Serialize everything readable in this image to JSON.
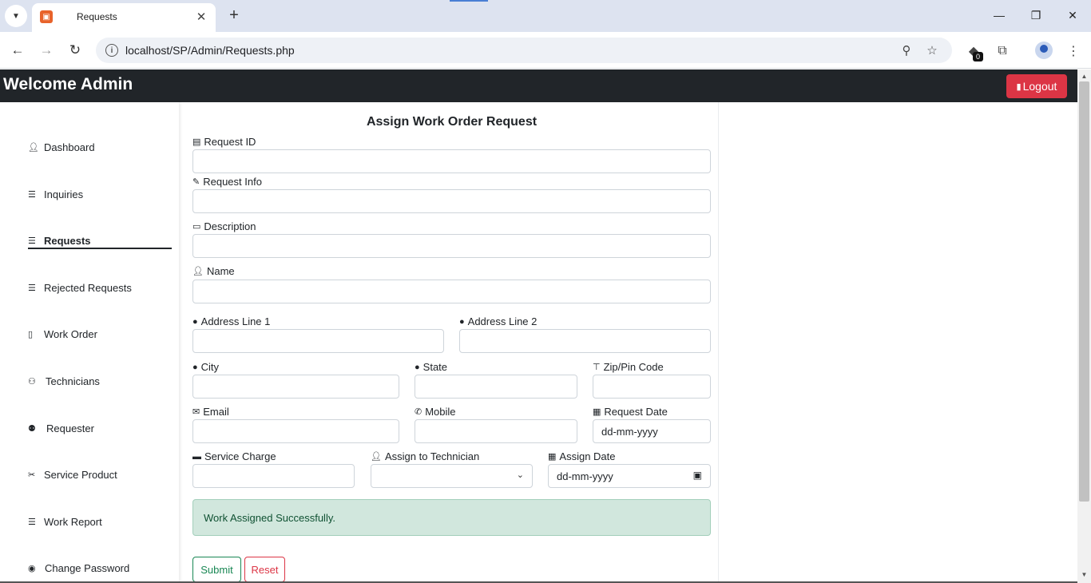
{
  "browser": {
    "tab_title": "Requests",
    "url": "localhost/SP/Admin/Requests.php",
    "extension_badge": "0"
  },
  "header": {
    "brand": "Welcome Admin",
    "logout_label": "Logout"
  },
  "sidebar": {
    "items": [
      {
        "label": "Dashboard",
        "icon": "user-icon"
      },
      {
        "label": "Inquiries",
        "icon": "list-icon"
      },
      {
        "label": "Requests",
        "icon": "list-icon"
      },
      {
        "label": "Rejected Requests",
        "icon": "list-icon"
      },
      {
        "label": "Work Order",
        "icon": "clipboard-icon"
      },
      {
        "label": "Technicians",
        "icon": "users-icon"
      },
      {
        "label": "Requester",
        "icon": "user-group-icon"
      },
      {
        "label": "Service Product",
        "icon": "tools-icon"
      },
      {
        "label": "Work Report",
        "icon": "list-icon"
      },
      {
        "label": "Change Password",
        "icon": "eye-icon"
      }
    ],
    "active": "Requests"
  },
  "form": {
    "title": "Assign Work Order Request",
    "fields": {
      "request_id": {
        "label": "Request ID",
        "value": ""
      },
      "request_info": {
        "label": "Request Info",
        "value": ""
      },
      "description": {
        "label": "Description",
        "value": ""
      },
      "name": {
        "label": "Name",
        "value": ""
      },
      "address1": {
        "label": "Address Line 1",
        "value": ""
      },
      "address2": {
        "label": "Address Line 2",
        "value": ""
      },
      "city": {
        "label": "City",
        "value": ""
      },
      "state": {
        "label": "State",
        "value": ""
      },
      "zip": {
        "label": "Zip/Pin Code",
        "value": ""
      },
      "email": {
        "label": "Email",
        "value": ""
      },
      "mobile": {
        "label": "Mobile",
        "value": ""
      },
      "request_date": {
        "label": "Request Date",
        "value": "dd-mm-yyyy"
      },
      "service_charge": {
        "label": "Service Charge",
        "value": ""
      },
      "assign_tech": {
        "label": "Assign to Technician",
        "value": ""
      },
      "assign_date": {
        "label": "Assign Date",
        "value": "dd-mm-yyyy"
      }
    },
    "alert": "Work Assigned Successfully.",
    "submit_label": "Submit",
    "reset_label": "Reset"
  }
}
